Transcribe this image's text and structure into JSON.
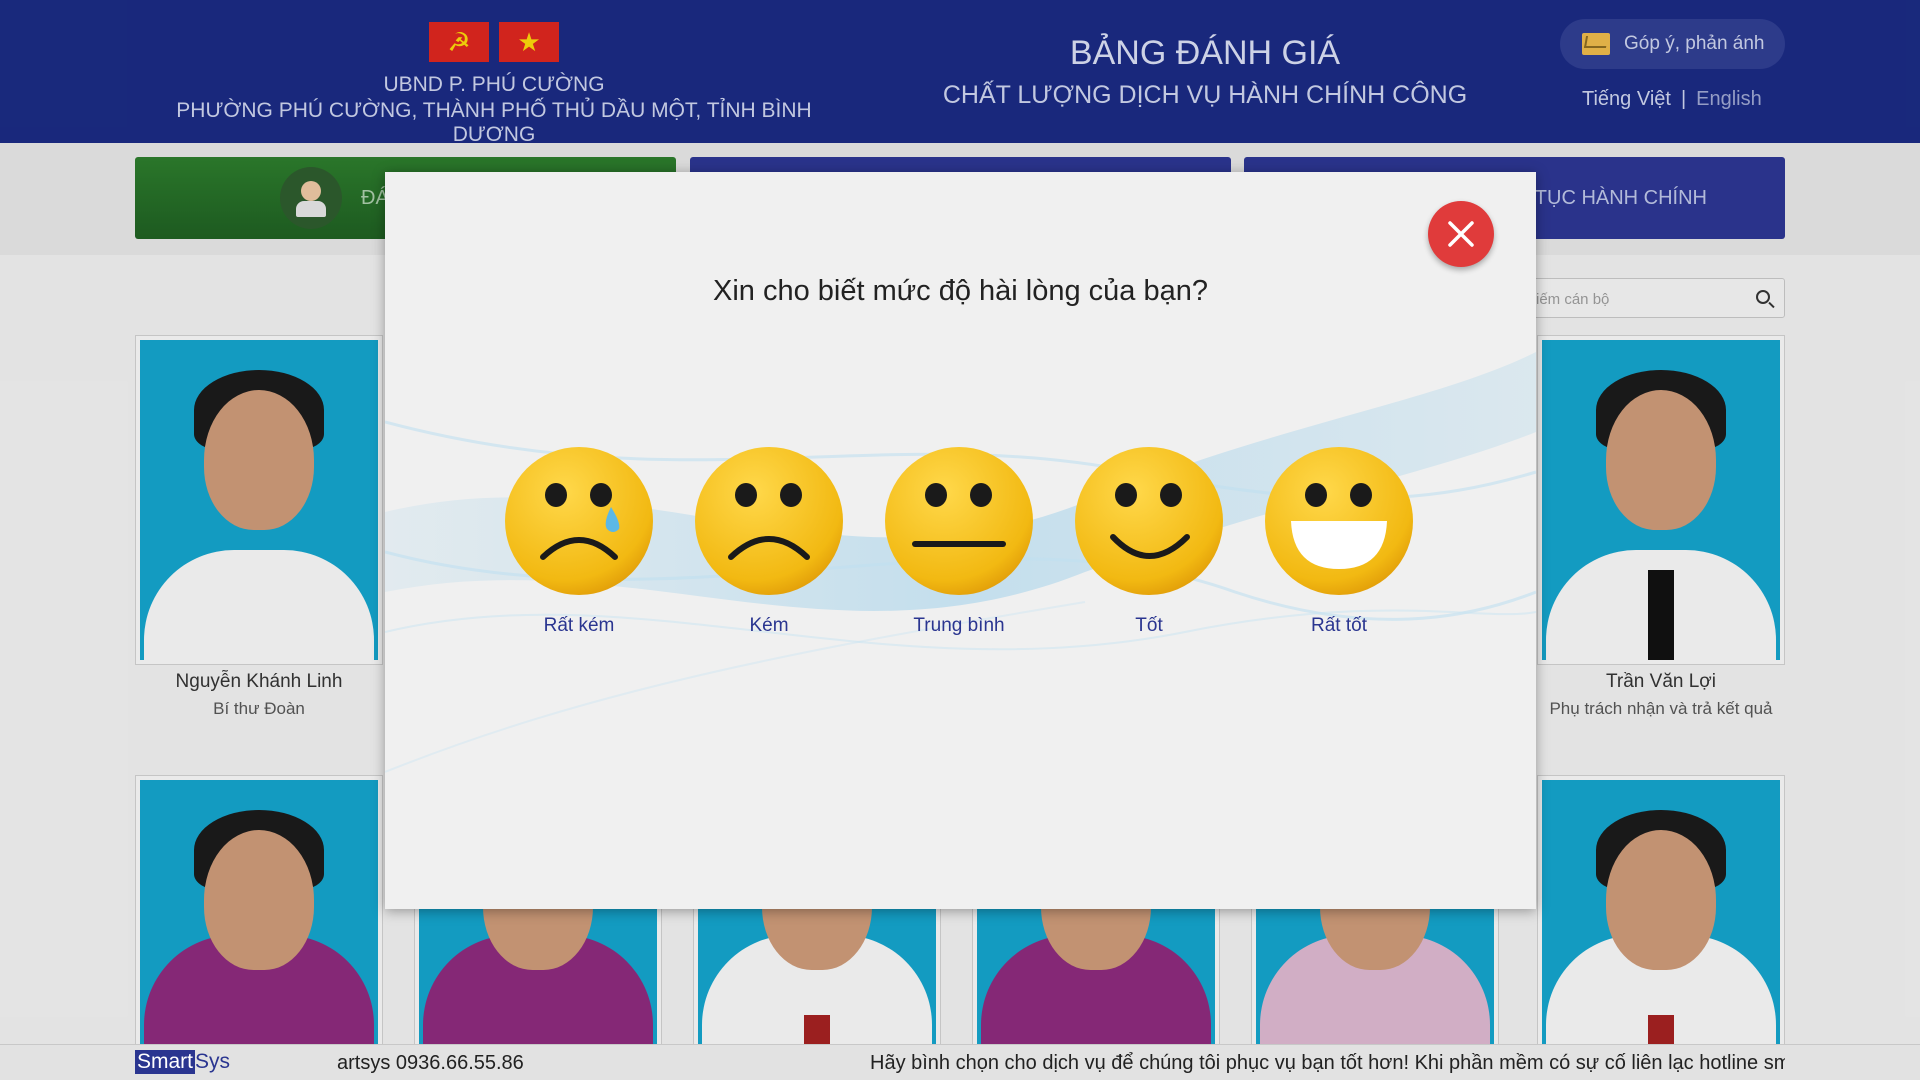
{
  "header": {
    "org_line1": "UBND P. PHÚ CƯỜNG",
    "org_line2": "PHƯỜNG PHÚ CƯỜNG, THÀNH PHỐ THỦ DẦU MỘT, TỈNH BÌNH DƯƠNG",
    "title_line1": "BẢNG ĐÁNH GIÁ",
    "title_line2": "CHẤT LƯỢNG DỊCH VỤ HÀNH CHÍNH CÔNG",
    "feedback_label": "Góp ý, phản ánh",
    "lang_vi": "Tiếng Việt",
    "lang_sep": "|",
    "lang_en": "English",
    "flag_party_glyph": "☭",
    "flag_nation_glyph": "★"
  },
  "nav": {
    "tab1_label": "ĐÁ",
    "tab3_label": "TỤC HÀNH CHÍNH"
  },
  "search": {
    "placeholder": "iếm cán bộ"
  },
  "staff": [
    {
      "name": "Nguyễn Khánh Linh",
      "role": "Bí thư Đoàn"
    },
    {
      "name": "Trần Văn Lợi",
      "role": "Phụ trách nhận và trả kết quả"
    }
  ],
  "modal": {
    "question": "Xin cho biết mức độ hài lòng của bạn?",
    "ratings": [
      {
        "label": "Rất kém",
        "icon": "crying-face-icon"
      },
      {
        "label": "Kém",
        "icon": "sad-face-icon"
      },
      {
        "label": "Trung bình",
        "icon": "neutral-face-icon"
      },
      {
        "label": "Tốt",
        "icon": "smile-face-icon"
      },
      {
        "label": "Rất tốt",
        "icon": "grin-face-icon"
      }
    ],
    "close_icon": "close-icon"
  },
  "footer": {
    "logo_smart": "Smart",
    "logo_sys": "Sys",
    "marquee_tail": "artsys 0936.66.55.86",
    "marquee_text": "Hãy bình chọn cho dịch vụ để chúng tôi phục vụ bạn tốt hơn! Khi phần mềm có sự cố liên lạc hotline sma"
  },
  "colors": {
    "header_bg": "#1a2a80",
    "nav_green": "#2c7a2c",
    "nav_blue": "#2c3590",
    "close_red": "#e03b3b",
    "emoji_yellow": "#f7c21a",
    "label_blue": "#2a3590"
  }
}
